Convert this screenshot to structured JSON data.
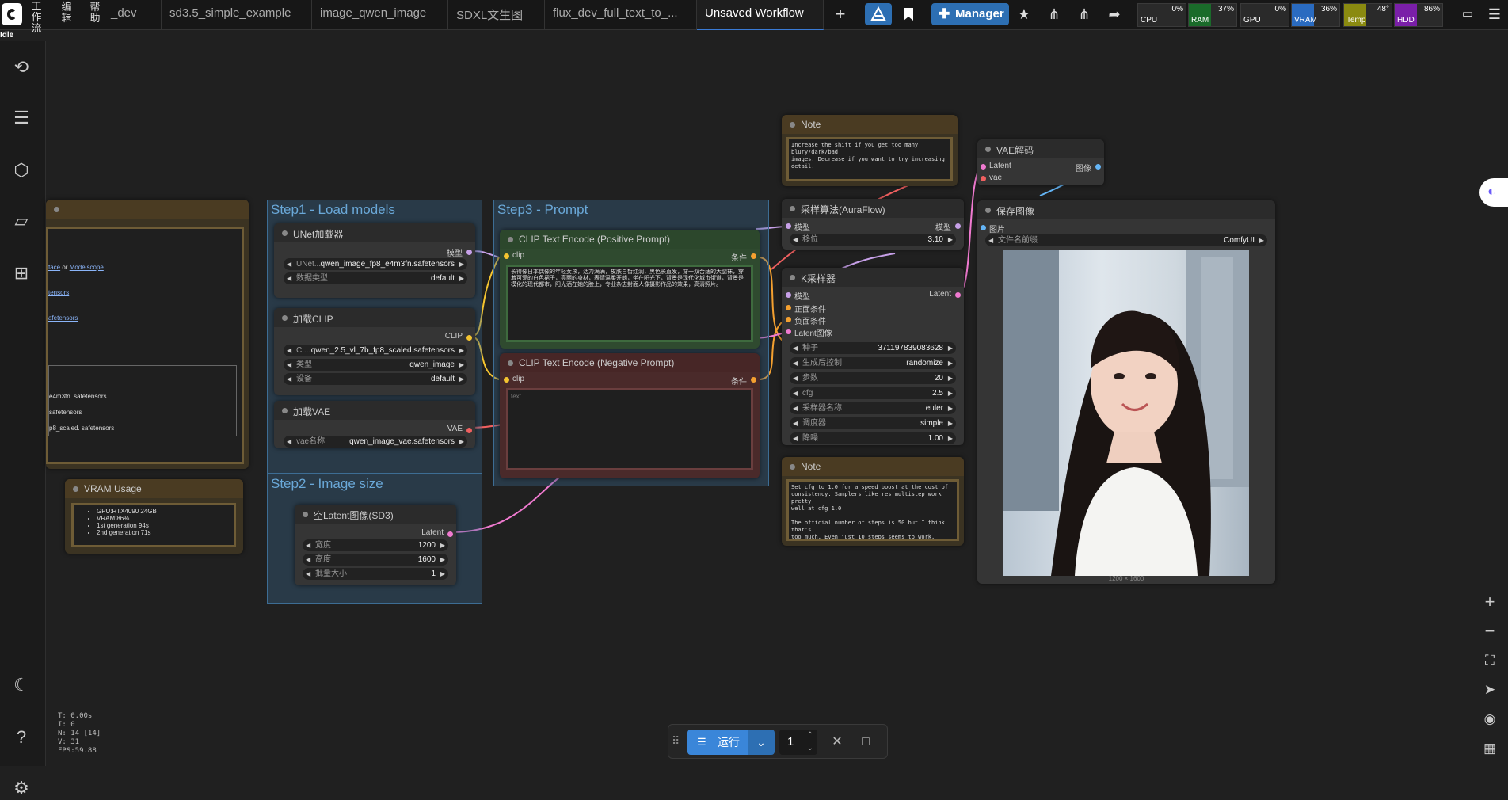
{
  "menu": {
    "workflow": [
      "工",
      "作",
      "流"
    ],
    "edit": [
      "编",
      "辑"
    ],
    "help": [
      "帮",
      "助"
    ]
  },
  "tabs": [
    "_dev",
    "sd3.5_simple_example",
    "image_qwen_image",
    "SDXL文生图",
    "flux_dev_full_text_to_...",
    "Unsaved Workflow"
  ],
  "toolbar": {
    "add": "+",
    "manager": "Manager"
  },
  "meters": [
    {
      "label": "CPU",
      "value": "0%",
      "pct": 0,
      "color": "#2a2a2a"
    },
    {
      "label": "RAM",
      "value": "37%",
      "pct": 37,
      "color": "#1a6b2a"
    },
    {
      "label": "GPU",
      "value": "0%",
      "pct": 0,
      "color": "#2a2a2a"
    },
    {
      "label": "VRAM",
      "value": "36%",
      "pct": 36,
      "color": "#2a6bc0"
    },
    {
      "label": "Temp",
      "value": "48°",
      "pct": 48,
      "color": "#8a8a10"
    },
    {
      "label": "HDD",
      "value": "86%",
      "pct": 86,
      "color": "#7a1fa8"
    }
  ],
  "status": "Idle",
  "groups": {
    "step1": "Step1 - Load models",
    "step2": "Step2 - Image size",
    "step3": "Step3 - Prompt"
  },
  "left_node": {
    "link_a": "face",
    "link_or": " or ",
    "link_b": "Modelscope",
    "l1": "tensors",
    "l2": "afetensors",
    "f1": "e4m3fn. safetensors",
    "f2": "safetensors",
    "f3": "p8_scaled. safetensors"
  },
  "vram": {
    "title": "VRAM Usage",
    "items": [
      "GPU:RTX4090 24GB",
      "VRAM:86%",
      "1st generation 94s",
      "2nd generation 71s"
    ]
  },
  "unet": {
    "title": "UNet加载器",
    "out": "模型",
    "w1_label": "UNet...",
    "w1_value": "qwen_image_fp8_e4m3fn.safetensors",
    "w2_label": "数据类型",
    "w2_value": "default"
  },
  "clipload": {
    "title": "加载CLIP",
    "out": "CLIP",
    "w1_label": "C ...",
    "w1_value": "qwen_2.5_vl_7b_fp8_scaled.safetensors",
    "w2_label": "类型",
    "w2_value": "qwen_image",
    "w3_label": "设备",
    "w3_value": "default"
  },
  "vaeload": {
    "title": "加载VAE",
    "out": "VAE",
    "w1_label": "vae名称",
    "w1_value": "qwen_image_vae.safetensors"
  },
  "latent": {
    "title": "空Latent图像(SD3)",
    "out": "Latent",
    "w1_label": "宽度",
    "w1_value": "1200",
    "w2_label": "高度",
    "w2_value": "1600",
    "w3_label": "批量大小",
    "w3_value": "1"
  },
  "pos": {
    "title": "CLIP Text Encode (Positive Prompt)",
    "in": "clip",
    "out": "条件",
    "text": "长得像日本偶像的年轻女孩，活力满满，皮肤白皙红润，黑色长直发，穿一双合适的大腿袜，穿着可爱的白色裙子，亮丽的身材，表情温柔开朗，坐在阳光下，背景是现代化城市街道，背景是模化的现代都市，阳光洒在她的脸上，专业杂志封面人像摄影作品的效果，高清照片。"
  },
  "neg": {
    "title": "CLIP Text Encode (Negative Prompt)",
    "in": "clip",
    "out": "条件",
    "placeholder": "text"
  },
  "note1": {
    "title": "Note",
    "text": "Increase the shift if you get too many blury/dark/bad\nimages. Decrease if you want to try increasing\ndetail."
  },
  "note2": {
    "title": "Note",
    "text": "Set cfg to 1.0 for a speed boost at the cost of\nconsistency. Samplers like res_multistep work pretty\nwell at cfg 1.0\n\nThe official number of steps is 50 but I think that's\ntoo much. Even just 10 steps seems to work."
  },
  "aura": {
    "title": "采样算法(AuraFlow)",
    "in": "模型",
    "out": "模型",
    "w1_label": "移位",
    "w1_value": "3.10"
  },
  "ksampler": {
    "title": "K采样器",
    "in": [
      "模型",
      "正面条件",
      "负面条件",
      "Latent图像"
    ],
    "out": "Latent",
    "widgets": [
      {
        "label": "种子",
        "value": "371197839083628"
      },
      {
        "label": "生成后控制",
        "value": "randomize"
      },
      {
        "label": "步数",
        "value": "20"
      },
      {
        "label": "cfg",
        "value": "2.5"
      },
      {
        "label": "采样器名称",
        "value": "euler"
      },
      {
        "label": "调度器",
        "value": "simple"
      },
      {
        "label": "降噪",
        "value": "1.00"
      }
    ]
  },
  "vaedecode": {
    "title": "VAE解码",
    "in1": "Latent",
    "in2": "vae",
    "out": "图像"
  },
  "save": {
    "title": "保存图像",
    "in": "图片",
    "w1_label": "文件名前缀",
    "w1_value": "ComfyUI",
    "size": "1200 × 1600"
  },
  "run": {
    "label": "运行",
    "count": "1"
  },
  "stats": [
    "T: 0.00s",
    "I: 0",
    "N: 14 [14]",
    "V: 31",
    "FPS:59.88"
  ]
}
